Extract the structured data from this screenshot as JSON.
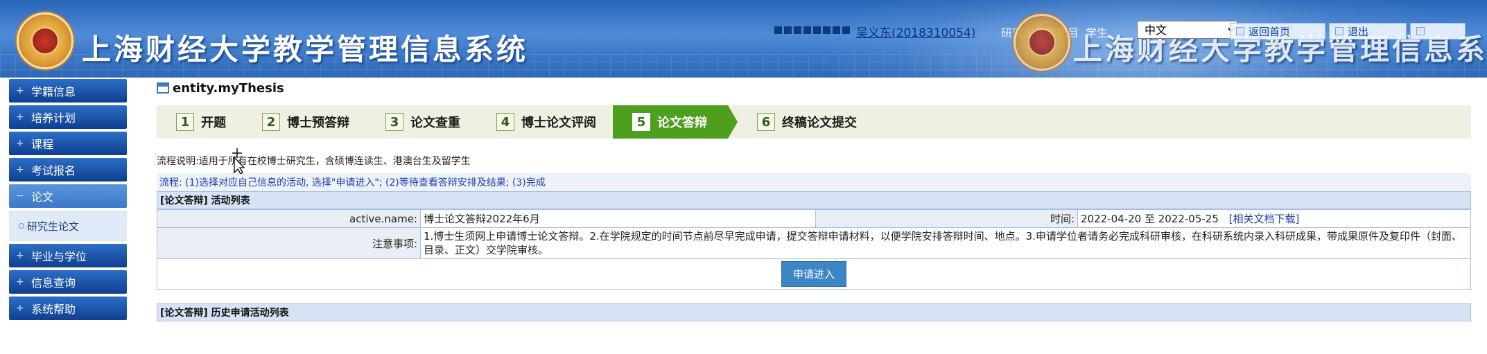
{
  "header": {
    "system_title": "上海财经大学教学管理信息系统",
    "user_link": "吴义东(2018310054)",
    "project_label": "研究生教学项目",
    "role_label": "学生",
    "language_selected": "中文",
    "home_label": "返回首页",
    "logout_label": "退出"
  },
  "sidebar": {
    "items": [
      {
        "label": "学籍信息"
      },
      {
        "label": "培养计划"
      },
      {
        "label": "课程"
      },
      {
        "label": "考试报名"
      },
      {
        "label": "论文"
      },
      {
        "label": "研究生论文"
      },
      {
        "label": "毕业与学位"
      },
      {
        "label": "信息查询"
      },
      {
        "label": "系统帮助"
      }
    ]
  },
  "main": {
    "title": "entity.myThesis",
    "steps": [
      {
        "num": "1",
        "label": "开题"
      },
      {
        "num": "2",
        "label": "博士预答辩"
      },
      {
        "num": "3",
        "label": "论文查重"
      },
      {
        "num": "4",
        "label": "博士论文评阅"
      },
      {
        "num": "5",
        "label": "论文答辩",
        "active": true
      },
      {
        "num": "6",
        "label": "终稿论文提交"
      }
    ],
    "flow_description": "流程说明:适用于所有在校博士研究生，含硕博连读生、港澳台生及留学生",
    "flow_steps": "流程: (1)选择对应自己信息的活动, 选择\"申请进入\"; (2)等待查看答辩安排及结果; (3)完成",
    "activity_section_title": "[论文答辩] 活动列表",
    "activity": {
      "name_label": "active.name:",
      "name_value": "博士论文答辩2022年6月",
      "time_label": "时间:",
      "time_value": "2022-04-20 至 2022-05-25",
      "doc_link": "[相关文档下载]",
      "notes_label": "注意事项:",
      "notes_value": "1.博士生须网上申请博士论文答辩。2.在学院规定的时间节点前尽早完成申请，提交答辩申请材料，以便学院安排答辩时间、地点。3.申请学位者请务必完成科研审核，在科研系统内录入科研成果，带成果原件及复印件（封面、目录、正文）交学院审核。",
      "apply_button": "申请进入"
    },
    "history_section_title": "[论文答辩] 历史申请活动列表"
  },
  "colors": {
    "header_blue": "#3c78c8",
    "nav_blue": "#0e3f8f",
    "active_step_green": "#4f9f1f",
    "link_blue": "#1c3fae",
    "apply_button": "#3d86c6"
  }
}
